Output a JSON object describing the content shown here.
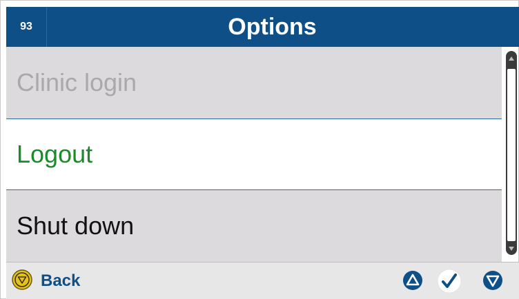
{
  "header": {
    "number": "93",
    "title": "Options"
  },
  "menu": {
    "items": [
      {
        "label": "Clinic login",
        "state": "disabled"
      },
      {
        "label": "Logout",
        "state": "selected"
      },
      {
        "label": "Shut down",
        "state": "normal"
      }
    ]
  },
  "footer": {
    "back_label": "Back",
    "back_icon": "stop-circle-icon",
    "up_icon": "triangle-up-icon",
    "ok_icon": "checkmark-icon",
    "down_icon": "triangle-down-icon"
  },
  "colors": {
    "header_bg": "#0d4f86",
    "selected_text": "#1b8a2a",
    "disabled_text": "#a9a9a9",
    "back_icon": "#e3c21f"
  }
}
